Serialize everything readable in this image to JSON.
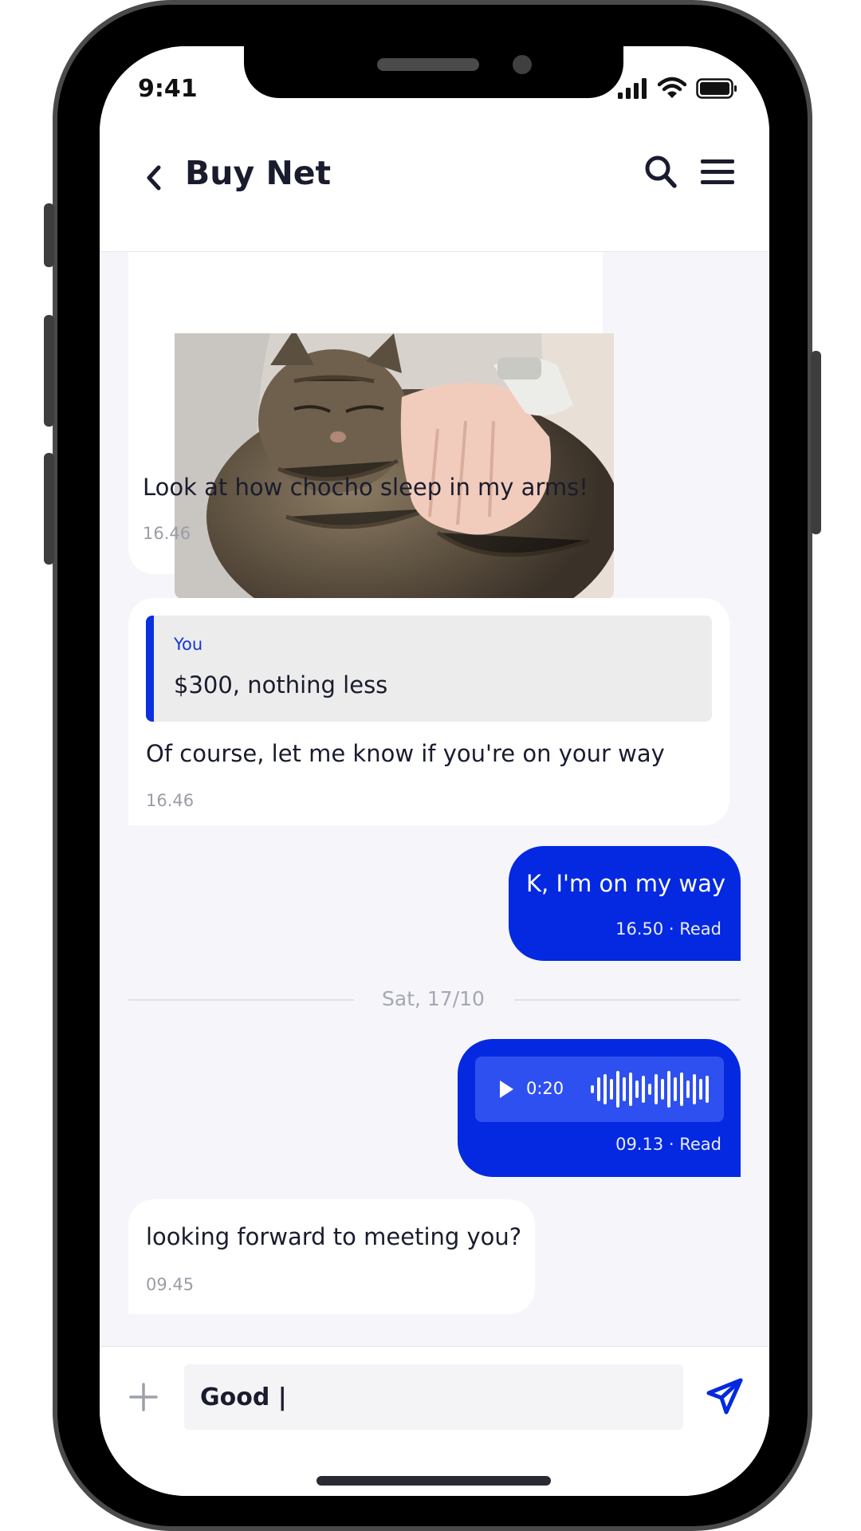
{
  "status_bar": {
    "time": "9:41"
  },
  "header": {
    "title": "Buy Net"
  },
  "messages": [
    {
      "text": "Look at how chocho sleep in my arms!",
      "time": "16.46"
    },
    {
      "quote_author": "You",
      "quote_text": "$300, nothing less",
      "text": "Of course, let me know if you're on your way",
      "time": "16.46"
    },
    {
      "text": "K, I'm on my way",
      "meta": "16.50 · Read"
    },
    {
      "audio_duration": "0:20",
      "meta": "09.13 · Read"
    },
    {
      "text": "looking forward to meeting you?",
      "time": "09.45"
    }
  ],
  "date_divider": "Sat, 17/10",
  "composer": {
    "value": "Good |"
  },
  "colors": {
    "accent": "#0429e0",
    "screen_bg": "#f6f6fa"
  },
  "icons": [
    "back-icon",
    "search-icon",
    "menu-icon",
    "play-icon",
    "plus-icon",
    "send-icon"
  ]
}
